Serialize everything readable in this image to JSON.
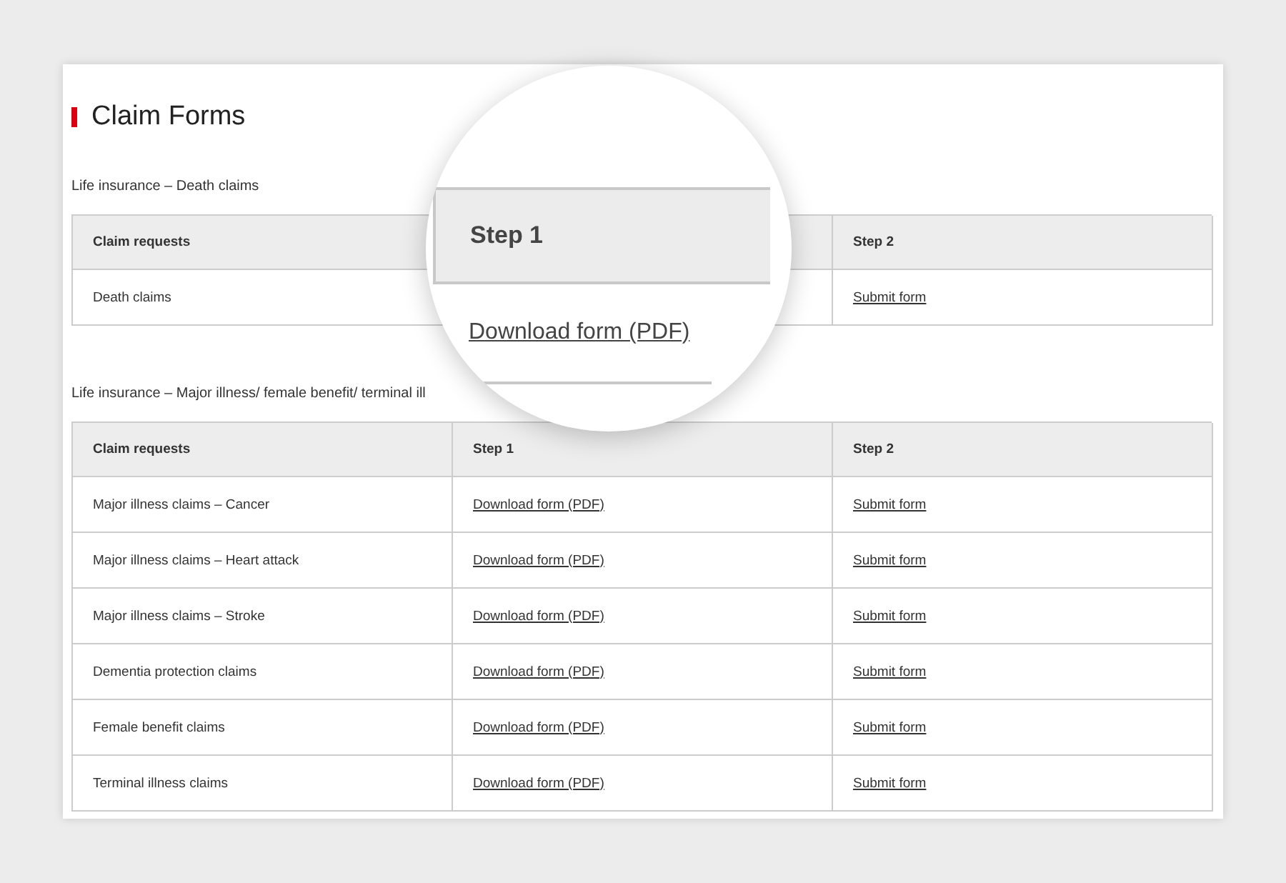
{
  "title": "Claim Forms",
  "sections": [
    {
      "heading": "Life insurance – Death claims",
      "columns": {
        "claim": "Claim requests",
        "step2": "Step 2"
      },
      "rows": [
        {
          "claim": "Death claims",
          "step2": "Submit form"
        }
      ]
    },
    {
      "heading": "Life insurance – Major illness/ female benefit/ terminal ill",
      "columns": {
        "claim": "Claim requests",
        "step1": "Step 1",
        "step2": "Step 2"
      },
      "rows": [
        {
          "claim": "Major illness claims – Cancer",
          "step1": "Download form (PDF)",
          "step2": "Submit form"
        },
        {
          "claim": "Major illness claims – Heart attack",
          "step1": "Download form (PDF)",
          "step2": "Submit form"
        },
        {
          "claim": "Major illness claims – Stroke",
          "step1": "Download form (PDF)",
          "step2": "Submit form"
        },
        {
          "claim": "Dementia protection claims",
          "step1": "Download form (PDF)",
          "step2": "Submit form"
        },
        {
          "claim": "Female benefit claims",
          "step1": "Download form (PDF)",
          "step2": "Submit form"
        },
        {
          "claim": "Terminal illness claims",
          "step1": "Download form (PDF)",
          "step2": "Submit form"
        }
      ]
    }
  ],
  "magnifier": {
    "header": "Step 1",
    "link": "Download form (PDF)"
  }
}
